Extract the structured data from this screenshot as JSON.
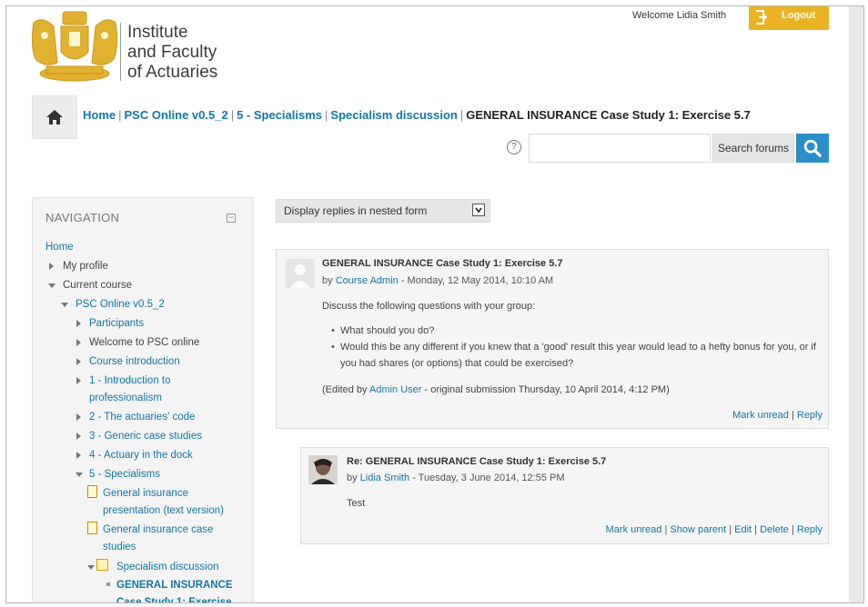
{
  "header": {
    "institute_lines": [
      "Institute",
      "and Faculty",
      "of Actuaries"
    ],
    "welcome": "Welcome Lidia Smith",
    "logout_label": "Logout"
  },
  "breadcrumb": {
    "items": [
      "Home",
      "PSC Online v0.5_2",
      "5 - Specialisms",
      "Specialism discussion"
    ],
    "current": "GENERAL INSURANCE Case Study 1: Exercise 5.7",
    "separator": "|"
  },
  "search": {
    "help_glyph": "?",
    "value": "",
    "button_label": "Search forums"
  },
  "navigation": {
    "title": "NAVIGATION",
    "collapse_glyph": "−",
    "items": [
      "Home",
      "My profile",
      "Current course",
      "PSC Online v0.5_2",
      "Participants",
      "Welcome to PSC online",
      "Course introduction",
      "1 - Introduction to",
      "professionalism",
      "2 - The actuaries' code",
      "3 - Generic case studies",
      "4 - Actuary in the dock",
      "5 - Specialisms",
      "General insurance",
      "presentation (text version)",
      "General insurance case",
      "studies",
      "Specialism discussion",
      "GENERAL INSURANCE",
      "Case Study 1: Exercise"
    ]
  },
  "display_mode": {
    "selected": "Display replies in nested form"
  },
  "posts": [
    {
      "subject": "GENERAL INSURANCE Case Study 1: Exercise 5.7",
      "by_prefix": "by",
      "author": "Course Admin",
      "date": " - Monday, 12 May 2014, 10:10 AM",
      "intro": "Discuss the following questions with your group:",
      "bullets": [
        "What should you do?",
        "Would this be any different if you knew that a 'good' result this year would lead to a hefty bonus for you, or if you had shares (or options) that could be exercised?"
      ],
      "edit_prefix": "(Edited by ",
      "edit_author": "Admin User",
      "edit_suffix": " - original submission Thursday, 10 April 2014, 4:12 PM)",
      "actions": [
        "Mark unread",
        "Reply"
      ]
    },
    {
      "subject": "Re: GENERAL INSURANCE Case Study 1: Exercise 5.7",
      "by_prefix": "by",
      "author": "Lidia Smith",
      "date": " - Tuesday, 3 June 2014, 12:55 PM",
      "body": "Test",
      "actions": [
        "Mark unread",
        "Show parent",
        "Edit",
        "Delete",
        "Reply"
      ]
    }
  ],
  "action_separator": "|",
  "colors": {
    "link": "#1177aa",
    "accent_gold": "#e9b323",
    "search_blue": "#2a8fc9",
    "panel_bg": "#f5f5f5"
  },
  "icons": [
    "crest-logo-icon",
    "logout-icon",
    "home-icon",
    "help-icon",
    "search-icon",
    "collapse-icon",
    "avatar-icon",
    "page-icon",
    "forum-icon"
  ]
}
